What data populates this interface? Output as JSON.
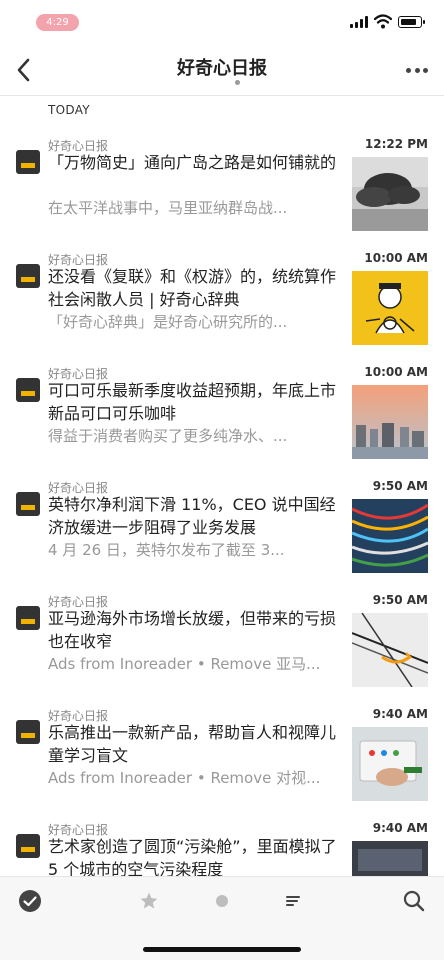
{
  "status_bar": {
    "time": "4:29"
  },
  "nav": {
    "title": "好奇心日报"
  },
  "section": {
    "label": "TODAY"
  },
  "articles": [
    {
      "source": "好奇心日报",
      "time": "12:22 PM",
      "title": "「万物简史」通向广岛之路是如何铺就的",
      "snippet": "在太平洋战事中，马里亚纳群岛战..."
    },
    {
      "source": "好奇心日报",
      "time": "10:00 AM",
      "title": "还没看《复联》和《权游》的，统统算作社会闲散人员 | 好奇心辞典",
      "snippet": "「好奇心辞典」是好奇心研究所的..."
    },
    {
      "source": "好奇心日报",
      "time": "10:00 AM",
      "title": "可口可乐最新季度收益超预期，年底上市新品可口可乐咖啡",
      "snippet": "得益于消费者购买了更多纯净水、..."
    },
    {
      "source": "好奇心日报",
      "time": "9:50 AM",
      "title": "英特尔净利润下滑 11%，CEO 说中国经济放缓进一步阻碍了业务发展",
      "snippet": "4 月 26 日，英特尔发布了截至 3..."
    },
    {
      "source": "好奇心日报",
      "time": "9:50 AM",
      "title": "亚马逊海外市场增长放缓，但带来的亏损也在收窄",
      "snippet": "Ads from Inoreader • Remove 亚马..."
    },
    {
      "source": "好奇心日报",
      "time": "9:40 AM",
      "title": "乐高推出一款新产品，帮助盲人和视障儿童学习盲文",
      "snippet": "Ads from Inoreader • Remove 对视..."
    },
    {
      "source": "好奇心日报",
      "time": "9:40 AM",
      "title": "艺术家创造了圆顶“污染舱”，里面模拟了 5 个城市的空气污染程度",
      "snippet": ""
    }
  ]
}
